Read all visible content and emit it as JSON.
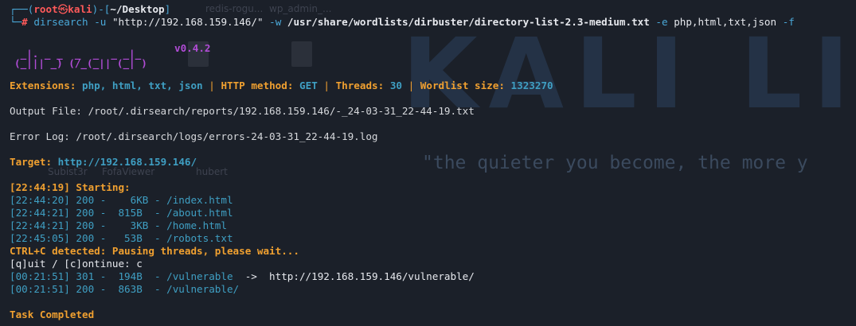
{
  "prompt": {
    "frame_top": "┌──(",
    "user": "root",
    "at": "㉿",
    "host": "kali",
    "close_open": ")-[",
    "path": "~/Desktop",
    "close_bracket": "]",
    "frame_bottom": "└─",
    "hash": "#",
    "command_name": "dirsearch",
    "arg_u": "-u",
    "url": "\"http://192.168.159.146/\"",
    "arg_w": "-w",
    "wordlist": "/usr/share/wordlists/dirbuster/directory-list-2.3-medium.txt",
    "arg_e": "-e",
    "extensions": "php,html,txt,json",
    "arg_f": "-f"
  },
  "banner": {
    "art_line1": " _|. _ _  _  _  _ _|_",
    "art_line2": "(_||| _) (/_(_|| (_| )",
    "version": "v0.4.2"
  },
  "summary": {
    "ext_label": "Extensions:",
    "ext_value": "php, html, txt, json",
    "method_label": "HTTP method:",
    "method_value": "GET",
    "threads_label": "Threads:",
    "threads_value": "30",
    "wordlist_label": "Wordlist size:",
    "wordlist_value": "1323270",
    "separator": "|"
  },
  "output_file": "Output File: /root/.dirsearch/reports/192.168.159.146/-_24-03-31_22-44-19.txt",
  "error_log": "Error Log: /root/.dirsearch/logs/errors-24-03-31_22-44-19.log",
  "target": {
    "label": "Target:",
    "url": "http://192.168.159.146/"
  },
  "starting": "[22:44:19] Starting:",
  "results_a": [
    {
      "text": "[22:44:20] 200 -    6KB - /index.html"
    },
    {
      "text": "[22:44:21] 200 -  815B  - /about.html"
    },
    {
      "text": "[22:44:21] 200 -    3KB - /home.html"
    },
    {
      "text": "[22:45:05] 200 -   53B  - /robots.txt"
    }
  ],
  "ctrl_c": "CTRL+C detected: Pausing threads, please wait...",
  "quit_prompt": "[q]uit / [c]ontinue: c",
  "results_b": [
    {
      "text": "[00:21:51] 301 -  194B  - /vulnerable",
      "arrow": "  ->  ",
      "redirect": "http://192.168.159.146/vulnerable/"
    },
    {
      "text": "[00:21:51] 200 -  863B  - /vulnerable/"
    }
  ],
  "task_completed": "Task Completed",
  "background": {
    "logo_text": "KALI LI",
    "slogan": "\"the quieter you become, the more y",
    "icons": [
      {
        "label": "redis-rogu..."
      },
      {
        "label": "wp_admin_..."
      },
      {
        "label": "Subist3r"
      },
      {
        "label": "FofaViewer"
      },
      {
        "label": "hubert"
      }
    ]
  },
  "colors": {
    "background": "#1b2029",
    "prompt_frame": "#4aa8d8",
    "user_host": "#ff5a5a",
    "command": "#4aa8d8",
    "highlight": "#f0a030",
    "value": "#3f9fc3",
    "banner": "#b14cd6"
  }
}
